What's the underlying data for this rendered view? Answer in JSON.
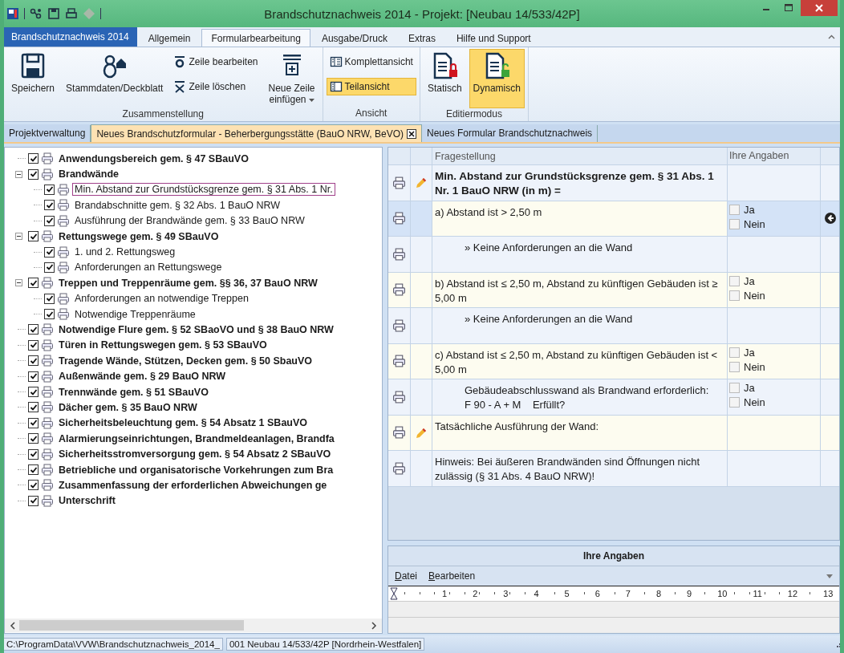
{
  "window": {
    "title": "Brandschutznachweis 2014 - Projekt: [Neubau 14/533/42P]"
  },
  "ribbon": {
    "file_tab": "Brandschutznachweis 2014",
    "tabs": [
      {
        "label": "Allgemein",
        "selected": false
      },
      {
        "label": "Formularbearbeitung",
        "selected": true
      },
      {
        "label": "Ausgabe/Druck",
        "selected": false
      },
      {
        "label": "Extras",
        "selected": false
      },
      {
        "label": "Hilfe und Support",
        "selected": false
      }
    ],
    "groups": [
      {
        "label": "Zusammenstellung",
        "items": [
          {
            "kind": "large",
            "label": "Speichern",
            "active": false
          },
          {
            "kind": "large",
            "label": "Stammdaten/Deckblatt",
            "active": false
          },
          {
            "kind": "stack",
            "items": [
              {
                "label": "Zeile bearbeiten",
                "active": false
              },
              {
                "label": "Zeile löschen",
                "active": false
              }
            ]
          },
          {
            "kind": "large",
            "label": "Neue Zeile\neinfügen",
            "active": false,
            "dropdown": true
          }
        ]
      },
      {
        "label": "Ansicht",
        "items": [
          {
            "kind": "stack",
            "items": [
              {
                "label": "Komplettansicht",
                "active": false
              },
              {
                "label": "Teilansicht",
                "active": true
              }
            ]
          }
        ]
      },
      {
        "label": "Editiermodus",
        "items": [
          {
            "kind": "large",
            "label": "Statisch",
            "active": false
          },
          {
            "kind": "large",
            "label": "Dynamisch",
            "active": true
          }
        ]
      }
    ]
  },
  "doc_tabs": [
    {
      "label": "Projektverwaltung",
      "selected": false,
      "closable": false
    },
    {
      "label": "Neues Brandschutzformular - Beherbergungsstätte (BauO NRW, BeVO)",
      "selected": true,
      "closable": true
    },
    {
      "label": "Neues Formular Brandschutznachweis",
      "selected": false,
      "closable": false
    }
  ],
  "tree": {
    "items": [
      {
        "label": "Anwendungsbereich gem. § 47 SBauVO",
        "checked": true,
        "selected": false
      },
      {
        "label": "Brandwände",
        "checked": true,
        "selected": false,
        "expanded": true,
        "children": [
          {
            "label": "Min. Abstand zur Grundstücksgrenze gem. § 31 Abs. 1 Nr.",
            "checked": true,
            "selected": true
          },
          {
            "label": "Brandabschnitte gem. § 32 Abs. 1 BauO NRW",
            "checked": true,
            "selected": false
          },
          {
            "label": "Ausführung der Brandwände gem. § 33 BauO NRW",
            "checked": true,
            "selected": false
          }
        ]
      },
      {
        "label": "Rettungswege gem. § 49 SBauVO",
        "checked": true,
        "selected": false,
        "expanded": true,
        "children": [
          {
            "label": "1. und 2. Rettungsweg",
            "checked": true,
            "selected": false
          },
          {
            "label": "Anforderungen an Rettungswege",
            "checked": true,
            "selected": false
          }
        ]
      },
      {
        "label": "Treppen und Treppenräume gem. §§ 36, 37 BauO NRW",
        "checked": true,
        "selected": false,
        "expanded": true,
        "children": [
          {
            "label": "Anforderungen an notwendige Treppen",
            "checked": true,
            "selected": false
          },
          {
            "label": "Notwendige Treppenräume",
            "checked": true,
            "selected": false
          }
        ]
      },
      {
        "label": "Notwendige Flure gem. § 52 SBaoVO und § 38 BauO NRW",
        "checked": true,
        "selected": false
      },
      {
        "label": "Türen in Rettungswegen gem. § 53 SBauVO",
        "checked": true,
        "selected": false
      },
      {
        "label": "Tragende Wände, Stützen, Decken gem. § 50 SbauVO",
        "checked": true,
        "selected": false
      },
      {
        "label": "Außenwände gem. § 29 BauO NRW",
        "checked": true,
        "selected": false
      },
      {
        "label": "Trennwände gem. § 51 SBauVO",
        "checked": true,
        "selected": false
      },
      {
        "label": "Dächer gem. § 35 BauO NRW",
        "checked": true,
        "selected": false
      },
      {
        "label": "Sicherheitsbeleuchtung gem. § 54 Absatz 1 SBauVO",
        "checked": true,
        "selected": false
      },
      {
        "label": "Alarmierungseinrichtungen, Brandmeldeanlagen, Brandfa",
        "checked": true,
        "selected": false
      },
      {
        "label": "Sicherheitsstromversorgung gem. § 54 Absatz 2 SBauVO",
        "checked": true,
        "selected": false
      },
      {
        "label": "Betriebliche und organisatorische Vorkehrungen zum Bra",
        "checked": true,
        "selected": false
      },
      {
        "label": "Zusammenfassung der erforderlichen Abweichungen ge",
        "checked": true,
        "selected": false
      },
      {
        "label": "Unterschrift",
        "checked": true,
        "selected": false
      }
    ]
  },
  "form": {
    "columns": [
      "Fragestellung",
      "Ihre Angaben"
    ],
    "rows": [
      {
        "text": "Min. Abstand zur Grundstücksgrenze gem. § 31 Abs. 1 Nr. 1 BauO NRW (in m) =",
        "bold": true,
        "indented": false,
        "editable": true,
        "selected": false
      },
      {
        "text": "a) Abstand ist > 2,50 m",
        "bold": false,
        "indented": false,
        "editable": false,
        "selected": true,
        "options": [
          {
            "label": "Ja",
            "checked": false
          },
          {
            "label": "Nein",
            "checked": false
          }
        ]
      },
      {
        "text": "» Keine Anforderungen an die Wand",
        "bold": false,
        "indented": true,
        "editable": false,
        "selected": false
      },
      {
        "text": "b) Abstand ist ≤ 2,50 m, Abstand zu künftigen Gebäuden ist ≥ 5,00 m",
        "bold": false,
        "indented": false,
        "editable": false,
        "selected": false,
        "options": [
          {
            "label": "Ja",
            "checked": false
          },
          {
            "label": "Nein",
            "checked": false
          }
        ]
      },
      {
        "text": "» Keine Anforderungen an die Wand",
        "bold": false,
        "indented": true,
        "editable": false,
        "selected": false
      },
      {
        "text": "c) Abstand ist ≤ 2,50 m, Abstand zu künftigen Gebäuden ist < 5,00 m",
        "bold": false,
        "indented": false,
        "editable": false,
        "selected": false,
        "options": [
          {
            "label": "Ja",
            "checked": false
          },
          {
            "label": "Nein",
            "checked": false
          }
        ]
      },
      {
        "text": "Gebäudeabschlusswand als Brandwand erforderlich:\nF 90 - A + M    Erfüllt?",
        "bold": false,
        "indented": true,
        "editable": false,
        "selected": false,
        "options": [
          {
            "label": "Ja",
            "checked": false
          },
          {
            "label": "Nein",
            "checked": false
          }
        ]
      },
      {
        "text": "Tatsächliche Ausführung der Wand:",
        "bold": false,
        "indented": false,
        "editable": true,
        "selected": false
      },
      {
        "text": "Hinweis: Bei äußeren Brandwänden sind Öffnungen nicht zulässig (§ 31 Abs. 4 BauO NRW)!",
        "bold": false,
        "indented": false,
        "editable": false,
        "selected": false
      }
    ]
  },
  "editor": {
    "title": "Ihre Angaben",
    "menu": [
      "Datei",
      "Bearbeiten"
    ],
    "ruler": [
      "1",
      "2",
      "3",
      "4",
      "5",
      "6",
      "7",
      "8",
      "9",
      "10",
      "11",
      "12",
      "13"
    ]
  },
  "status_bar": [
    "C:\\ProgramData\\VVW\\Brandschutznachweis_2014_",
    "001 Neubau 14/533/42P [Nordrhein-Westfalen]"
  ]
}
